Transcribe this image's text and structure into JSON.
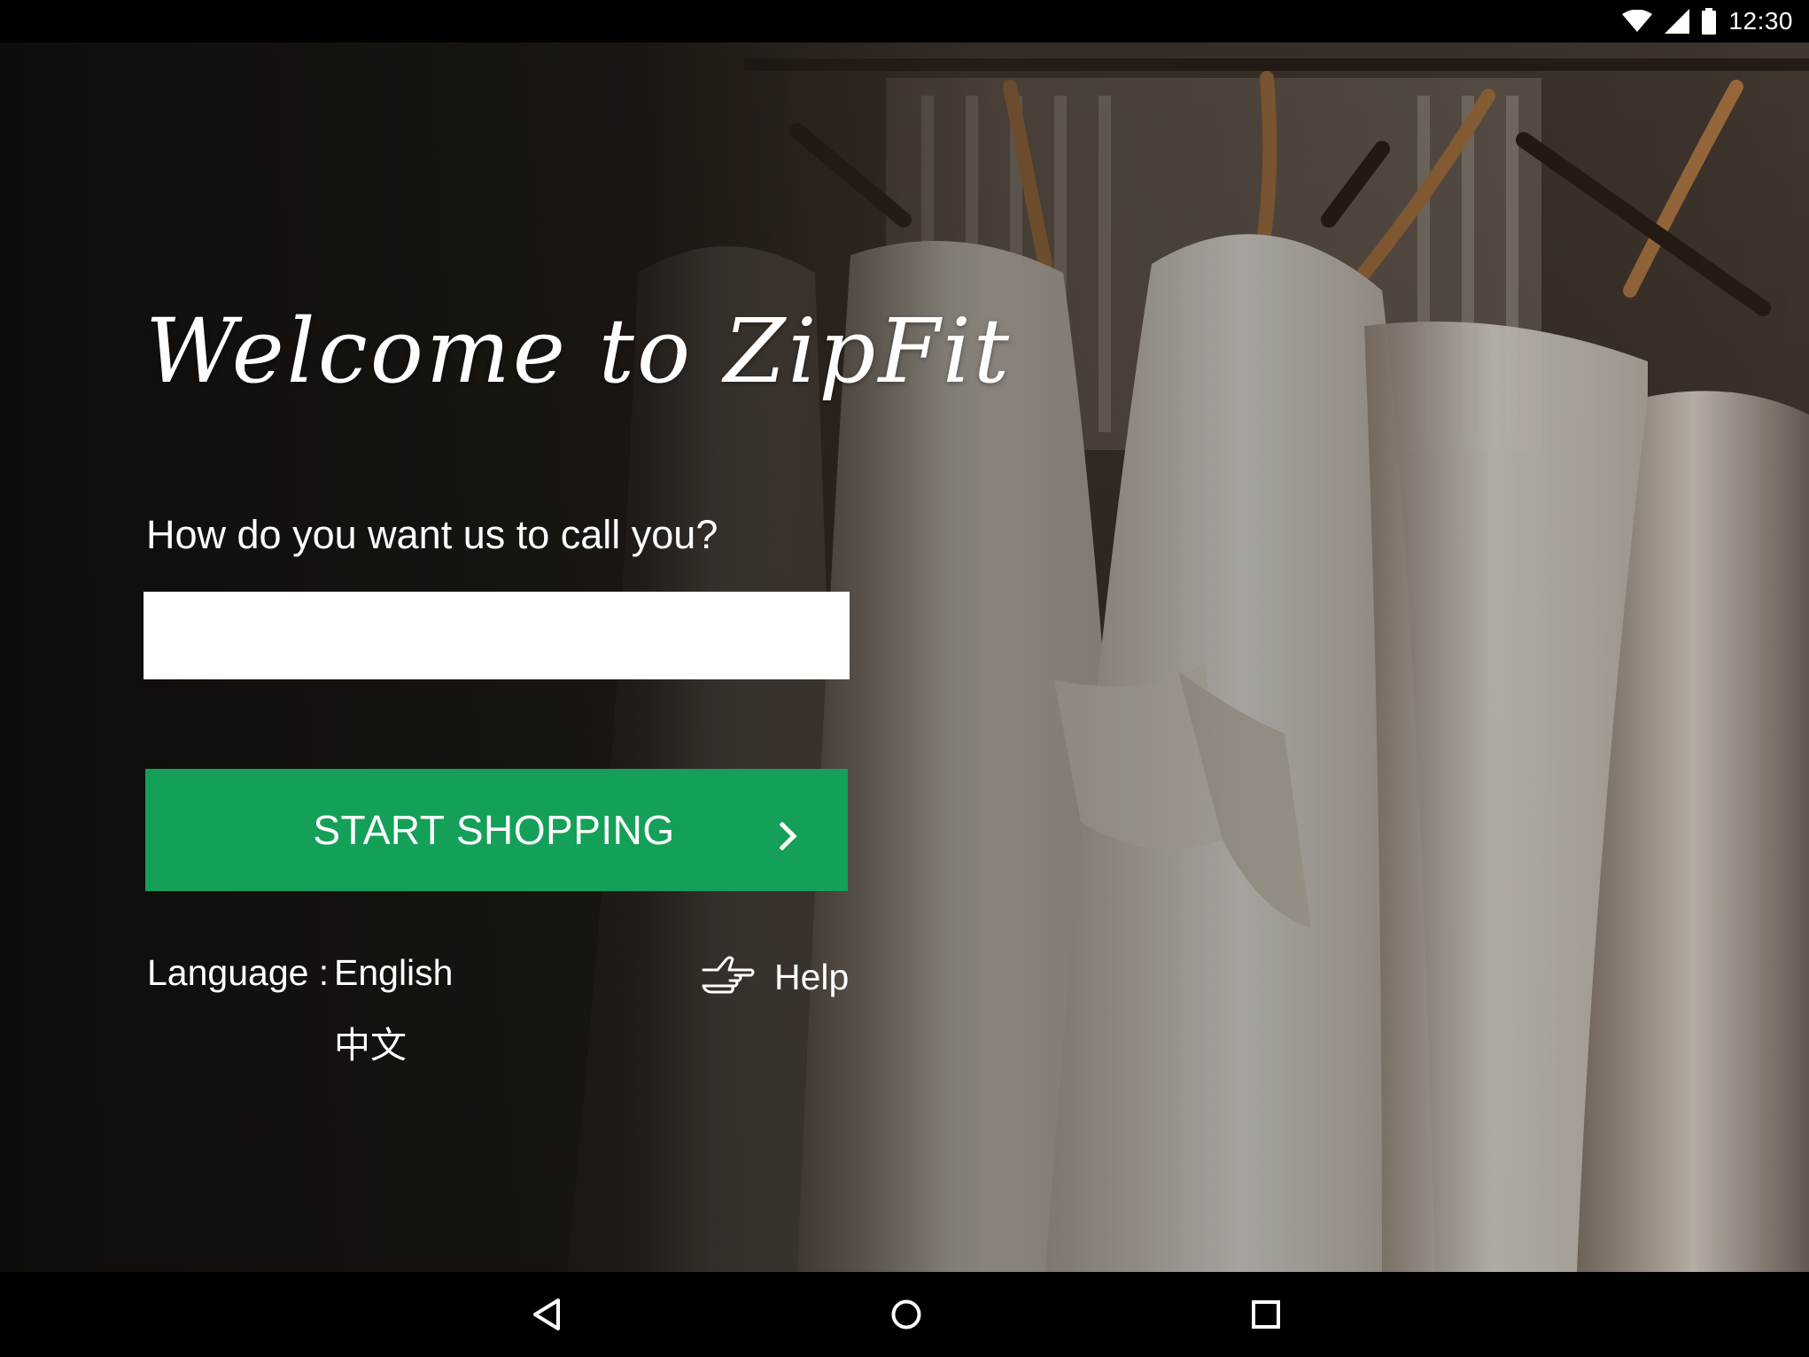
{
  "status_bar": {
    "time": "12:30",
    "icons": [
      "wifi-icon",
      "signal-icon",
      "battery-icon"
    ]
  },
  "welcome": {
    "title": "Welcome to ZipFit"
  },
  "name_form": {
    "prompt": "How do you want us to call you?",
    "input_value": "",
    "input_placeholder": ""
  },
  "start_button": {
    "label": "START SHOPPING",
    "icon": "chevron-right-icon"
  },
  "language": {
    "label": "Language :",
    "options": [
      "English",
      "中文"
    ]
  },
  "help": {
    "label": "Help",
    "icon": "pointing-hand-icon"
  },
  "nav_bar": {
    "buttons": [
      "back-icon",
      "home-icon",
      "recents-icon"
    ]
  },
  "colors": {
    "primary_button": "#14a058",
    "background": "#1a1512",
    "text": "#ffffff"
  }
}
